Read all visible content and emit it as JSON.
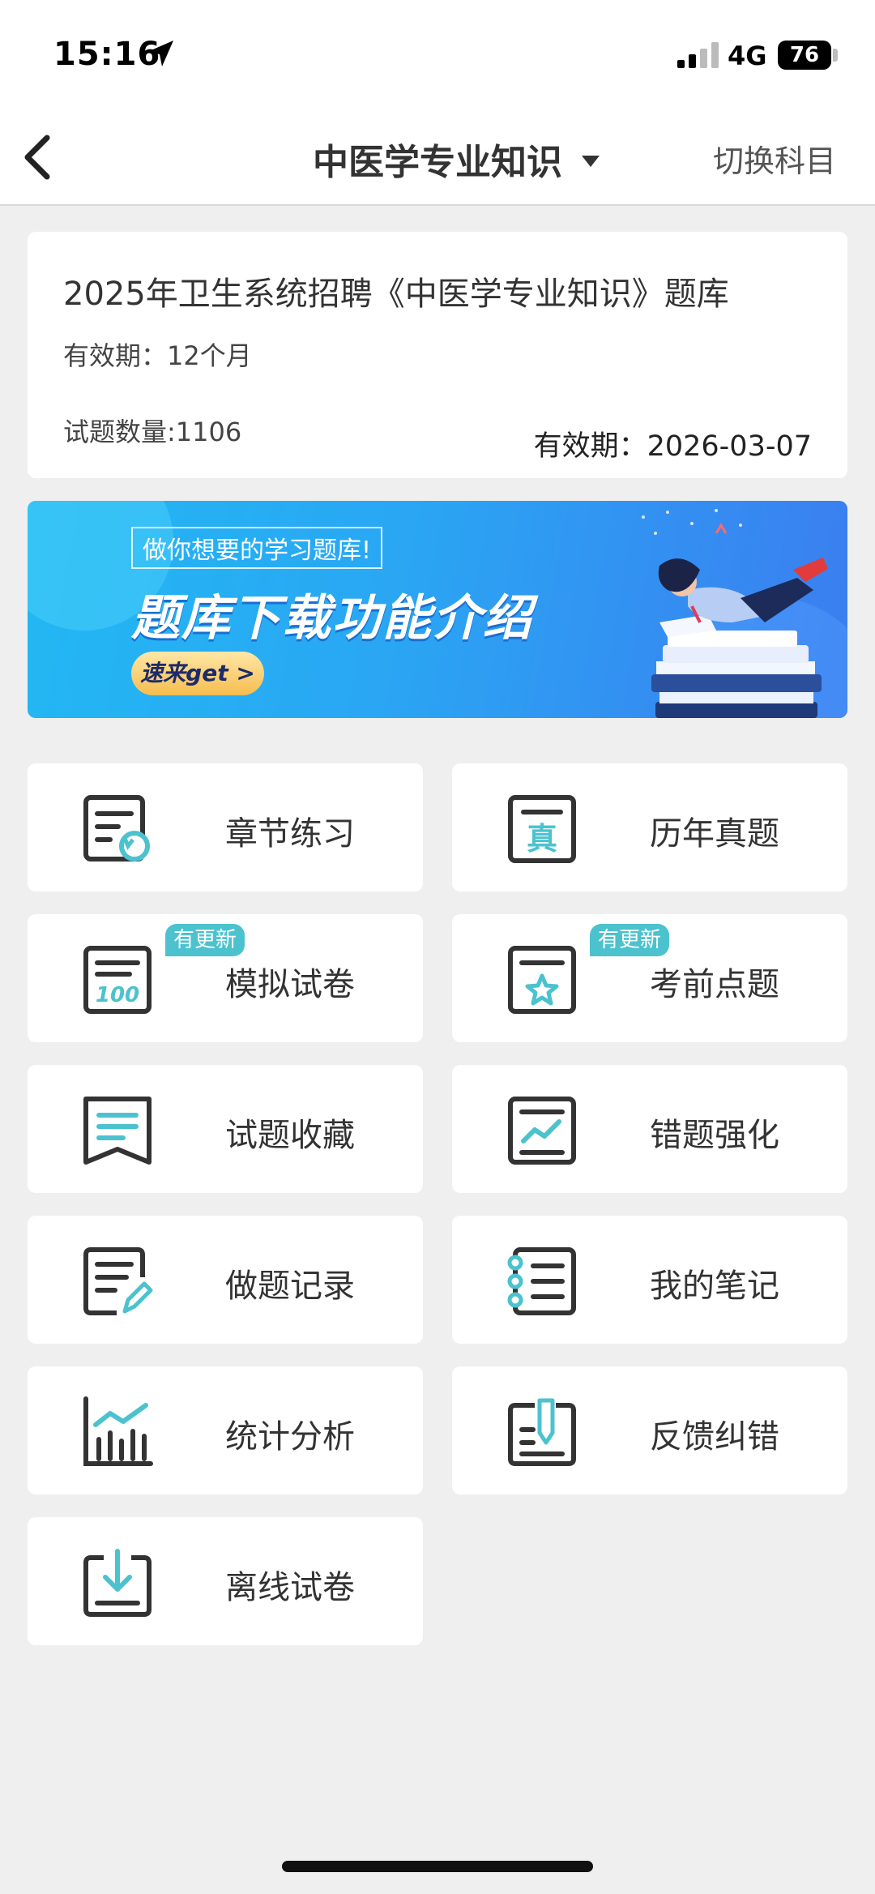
{
  "status_bar": {
    "time": "15:16",
    "network": "4G",
    "battery": "76"
  },
  "nav": {
    "title": "中医学专业知识",
    "switch_label": "切换科目"
  },
  "card": {
    "title": "2025年卫生系统招聘《中医学专业知识》题库",
    "validity": "有效期：12个月",
    "question_count": "试题数量:1106",
    "expire": "有效期：2026-03-07"
  },
  "banner": {
    "tag": "做你想要的学习题库!",
    "headline": "题库下载功能介绍",
    "cta": "速来get >"
  },
  "grid": [
    {
      "label": "章节练习",
      "icon": "chapter-practice-icon"
    },
    {
      "label": "历年真题",
      "icon": "past-exams-icon"
    },
    {
      "label": "模拟试卷",
      "icon": "mock-paper-icon",
      "badge": "有更新"
    },
    {
      "label": "考前点题",
      "icon": "key-questions-icon",
      "badge": "有更新"
    },
    {
      "label": "试题收藏",
      "icon": "bookmark-icon"
    },
    {
      "label": "错题强化",
      "icon": "wrong-questions-icon"
    },
    {
      "label": "做题记录",
      "icon": "record-icon"
    },
    {
      "label": "我的笔记",
      "icon": "notebook-icon"
    },
    {
      "label": "统计分析",
      "icon": "statistics-icon"
    },
    {
      "label": "反馈纠错",
      "icon": "feedback-icon"
    },
    {
      "label": "离线试卷",
      "icon": "download-icon"
    }
  ],
  "colors": {
    "accent": "#4cc2cf",
    "icon_stroke": "#333333"
  }
}
